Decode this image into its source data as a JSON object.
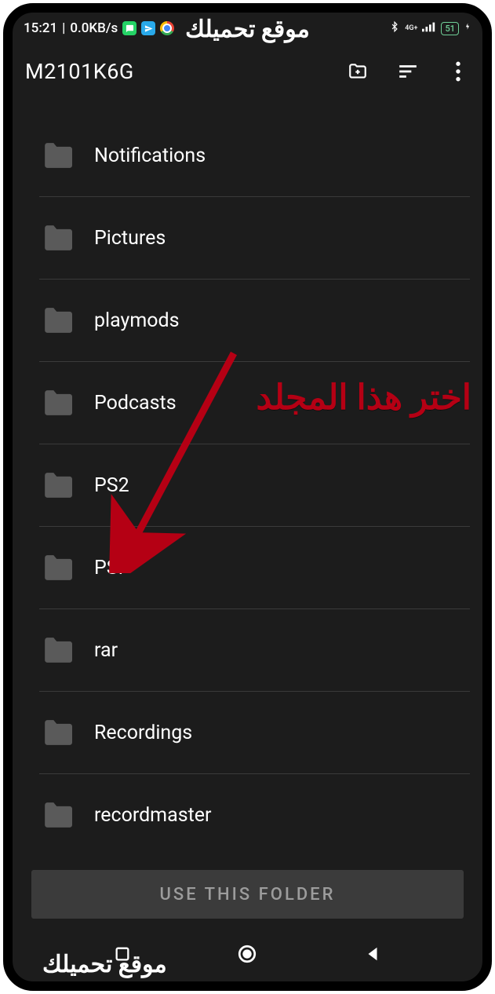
{
  "status": {
    "time": "15:21",
    "net_speed": "0.0KB/s",
    "network_type": "4G+",
    "battery_percent": "51"
  },
  "app": {
    "title": "M2101K6G"
  },
  "folders": [
    {
      "name": "Notifications"
    },
    {
      "name": "Pictures"
    },
    {
      "name": "playmods"
    },
    {
      "name": "Podcasts"
    },
    {
      "name": "PS2"
    },
    {
      "name": "PSP"
    },
    {
      "name": "rar"
    },
    {
      "name": "Recordings"
    },
    {
      "name": "recordmaster"
    }
  ],
  "buttons": {
    "use_folder": "USE THIS FOLDER"
  },
  "annotation": {
    "label": "اختر هذا المجلد",
    "watermark": "موقع تحميلك"
  }
}
